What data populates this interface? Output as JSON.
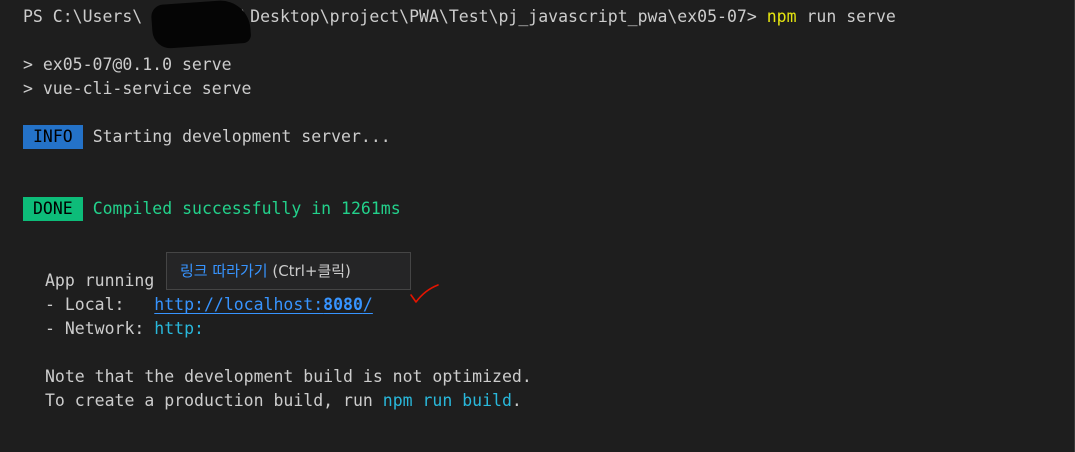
{
  "terminal": {
    "prompt": {
      "prefix": "PS C:\\Users\\",
      "redacted": "",
      "path": "\\Desktop\\project\\PWA\\Test\\pj_javascript_pwa\\ex05-07> ",
      "cmd_npm": "npm",
      "cmd_rest": " run serve"
    },
    "script_lines": [
      "> ex05-07@0.1.0 serve",
      "> vue-cli-service serve"
    ],
    "info": {
      "badge": "INFO",
      "message": "Starting development server..."
    },
    "done": {
      "badge": "DONE",
      "message": "Compiled successfully in 1261ms"
    },
    "app_running": "App running",
    "local": {
      "label": "- Local:   ",
      "url_base": "http://localhost:",
      "url_port": "8080",
      "url_tail": "/"
    },
    "network": {
      "label": "- Network: ",
      "url": "http:"
    },
    "note": "Note that the development build is not optimized.",
    "build": {
      "prefix": "To create a production build, run ",
      "command": "npm run build",
      "suffix": "."
    }
  },
  "tooltip": {
    "link_text": "링크 따라가기",
    "shortcut": " (Ctrl+클릭)"
  },
  "colors": {
    "background": "#1e1e1e",
    "text": "#cccccc",
    "info_badge": "#2472c8",
    "done_badge": "#0dbc79",
    "success": "#23d18b",
    "command": "#e5e510",
    "link": "#3794ff",
    "annotation": "#e51400"
  }
}
